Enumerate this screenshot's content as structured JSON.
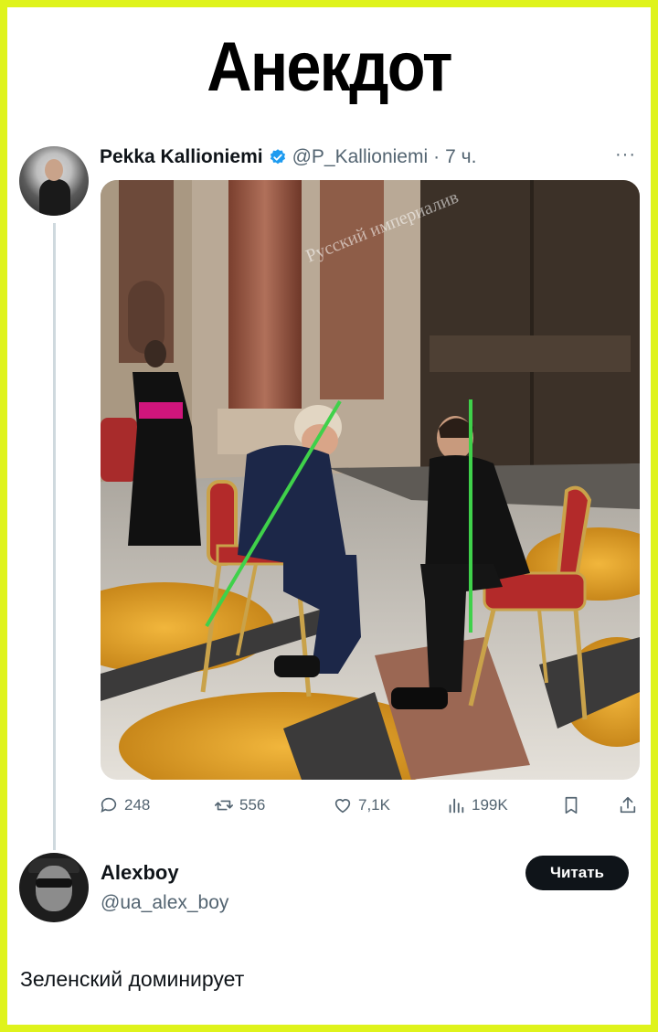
{
  "meme_title": "Анекдот",
  "tweet": {
    "author_name": "Pekka Kallioniemi",
    "author_handle": "@P_Kallioniemi",
    "separator": "·",
    "time": "7 ч.",
    "more": "···",
    "watermark": "Русский империалив",
    "stats": {
      "replies": "248",
      "retweets": "556",
      "likes": "7,1K",
      "views": "199K"
    }
  },
  "reply": {
    "author_name": "Alexboy",
    "author_handle": "@ua_alex_boy",
    "follow_label": "Читать",
    "text": "Зеленский доминирует"
  },
  "colors": {
    "frame": "#dff31b",
    "verified": "#1d9bf0",
    "annotation_line": "#3fd14a",
    "muted": "#536471"
  }
}
